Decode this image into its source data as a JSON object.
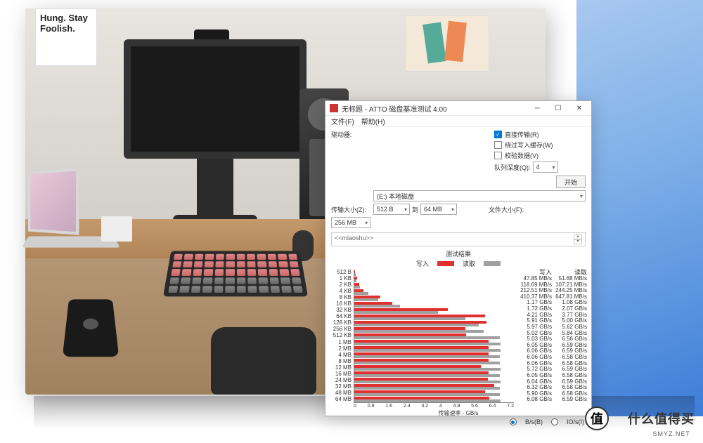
{
  "poster_text": "Hung.\nStay\nFoolish.",
  "window": {
    "title": "无标题 - ATTO 磁盘基准测试 4.00",
    "menu": {
      "file": "文件(F)",
      "help": "帮助(H)"
    },
    "labels": {
      "drive": "驱动器:",
      "transfer_size": "传输大小(Z):",
      "file_size": "文件大小(F):",
      "to": "到"
    },
    "drive_value": "(E:) 本地磁盘",
    "ts_from": "512 B",
    "ts_to": "64 MB",
    "fs_value": "256 MB",
    "checks": {
      "direct_io": {
        "label": "直接传输(R)",
        "checked": true
      },
      "bypass_cache": {
        "label": "绕过写入缓存(W)",
        "checked": false
      },
      "verify": {
        "label": "校验数据(V)",
        "checked": false
      }
    },
    "queue_depth": {
      "label": "队列深度(Q):",
      "value": "4"
    },
    "start_btn": "开始",
    "desc_placeholder": "<<miaoshu>>",
    "results_title": "测试结果",
    "legend": {
      "write": "写入",
      "read": "读取"
    },
    "col_write": "写入",
    "col_read": "读取",
    "xaxis_label": "传输速率 - GB/s",
    "radio_bs": "B/s(B)",
    "radio_ios": "IO/s(I)"
  },
  "chart_data": {
    "type": "bar",
    "title": "测试结果",
    "xlabel": "传输速率 - GB/s",
    "ylabel": "",
    "categories": [
      "512 B",
      "1 KB",
      "2 KB",
      "4 KB",
      "8 KB",
      "16 KB",
      "32 KB",
      "64 KB",
      "128 KB",
      "256 KB",
      "512 KB",
      "1 MB",
      "2 MB",
      "4 MB",
      "8 MB",
      "12 MB",
      "16 MB",
      "24 MB",
      "32 MB",
      "48 MB",
      "64 MB"
    ],
    "series": [
      {
        "name": "写入",
        "values_display": [
          "47.85 MB/s",
          "118.69 MB/s",
          "212.51 MB/s",
          "410.37 MB/s",
          "1.17 GB/s",
          "1.72 GB/s",
          "4.21 GB/s",
          "5.91 GB/s",
          "5.97 GB/s",
          "5.02 GB/s",
          "5.03 GB/s",
          "6.05 GB/s",
          "6.06 GB/s",
          "6.06 GB/s",
          "6.06 GB/s",
          "5.72 GB/s",
          "6.05 GB/s",
          "6.04 GB/s",
          "6.32 GB/s",
          "5.90 GB/s",
          "6.08 GB/s"
        ],
        "values_gbps": [
          0.0468,
          0.1159,
          0.2075,
          0.4008,
          1.17,
          1.72,
          4.21,
          5.91,
          5.97,
          5.02,
          5.03,
          6.05,
          6.06,
          6.06,
          6.06,
          5.72,
          6.05,
          6.04,
          6.32,
          5.9,
          6.08
        ]
      },
      {
        "name": "读取",
        "values_display": [
          "51.88 MB/s",
          "107.21 MB/s",
          "244.25 MB/s",
          "647.81 MB/s",
          "1.08 GB/s",
          "2.07 GB/s",
          "3.77 GB/s",
          "5.00 GB/s",
          "5.62 GB/s",
          "5.84 GB/s",
          "6.56 GB/s",
          "6.59 GB/s",
          "6.59 GB/s",
          "6.58 GB/s",
          "6.58 GB/s",
          "6.59 GB/s",
          "6.58 GB/s",
          "6.59 GB/s",
          "6.58 GB/s",
          "6.58 GB/s",
          "6.59 GB/s"
        ],
        "values_gbps": [
          0.0507,
          0.1047,
          0.2385,
          0.6326,
          1.08,
          2.07,
          3.77,
          5.0,
          5.62,
          5.84,
          6.56,
          6.59,
          6.59,
          6.58,
          6.58,
          6.59,
          6.58,
          6.59,
          6.58,
          6.58,
          6.59
        ]
      }
    ],
    "xlim": [
      0,
      7.2
    ],
    "xticks": [
      0,
      0.8,
      1.6,
      2.4,
      3.2,
      4.0,
      4.8,
      5.6,
      6.4,
      7.2
    ]
  },
  "watermark": {
    "logo": "值",
    "text": "什么值得买",
    "sub": "SMYZ.NET"
  }
}
